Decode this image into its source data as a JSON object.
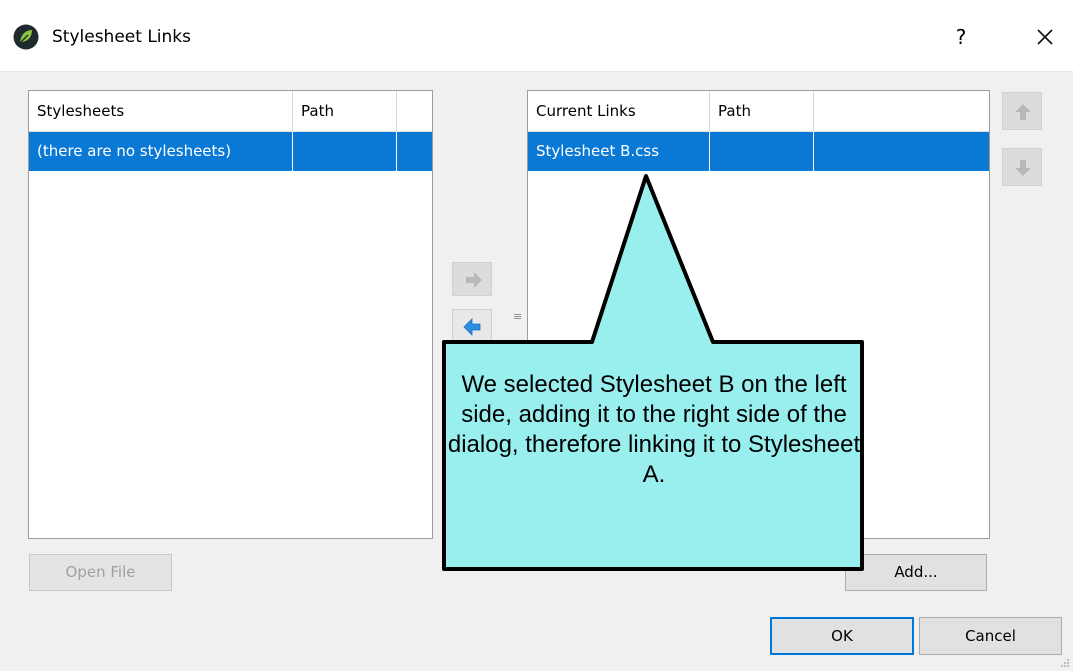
{
  "window": {
    "title": "Stylesheet Links",
    "help_label": "?"
  },
  "stylesheets_table": {
    "headers": [
      "Stylesheets",
      "Path"
    ],
    "rows": [
      {
        "name": "(there are no stylesheets)",
        "path": ""
      }
    ]
  },
  "current_links_table": {
    "headers": [
      "Current Links",
      "Path"
    ],
    "rows": [
      {
        "name": "Stylesheet B.css",
        "path": ""
      }
    ]
  },
  "buttons": {
    "open_file": "Open File",
    "add": "Add...",
    "ok": "OK",
    "cancel": "Cancel"
  },
  "icons": {
    "app": "flare-leaf-icon",
    "add_link": "right-arrow-icon",
    "remove_link": "left-arrow-icon",
    "move_up": "up-arrow-icon",
    "move_down": "down-arrow-icon",
    "close": "close-icon"
  },
  "callout": {
    "text": "We selected Stylesheet B on the left side, adding it to the right side of the dialog, therefore linking it to Stylesheet A.",
    "fill": "#99eeee"
  },
  "colors": {
    "selection": "#0a79d6",
    "default_button_border": "#0078d7"
  }
}
